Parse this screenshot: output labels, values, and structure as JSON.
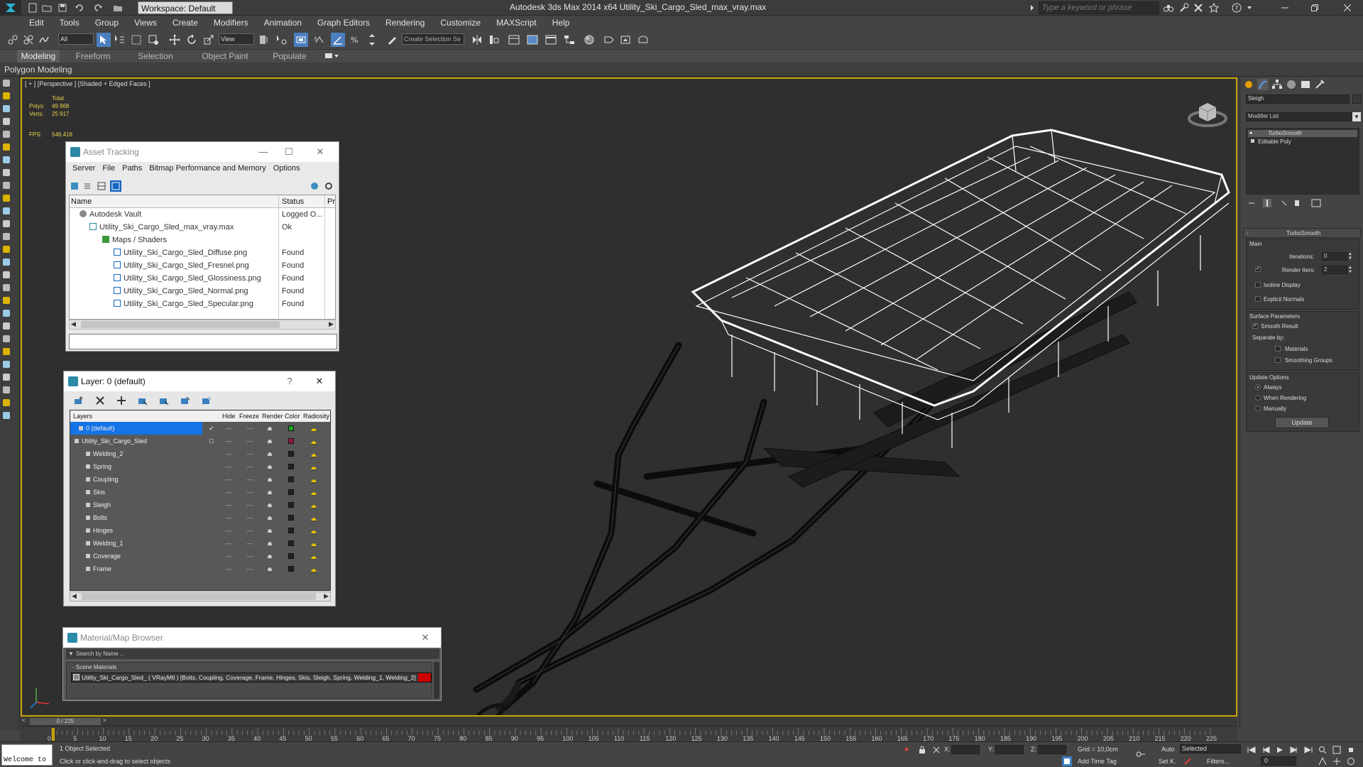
{
  "app": {
    "window_title": "Autodesk 3ds Max  2014 x64     Utility_Ski_Cargo_Sled_max_vray.max",
    "workspace_label": "Workspace: Default",
    "search_placeholder": "Type a keyword or phrase"
  },
  "menu": [
    "Edit",
    "Tools",
    "Group",
    "Views",
    "Create",
    "Modifiers",
    "Animation",
    "Graph Editors",
    "Rendering",
    "Customize",
    "MAXScript",
    "Help"
  ],
  "toolbar": {
    "selection_filter": "All",
    "ref_coord": "View",
    "named_selection": "Create Selection Se"
  },
  "ribbon": {
    "tabs": [
      "Modeling",
      "Freeform",
      "Selection",
      "Object Paint",
      "Populate"
    ],
    "active_tab": "Modeling",
    "subtab": "Polygon Modeling"
  },
  "viewport": {
    "label": "[ + ] [Perspective ] [Shaded + Edged Faces ]",
    "stats": {
      "total_label": "Total",
      "polys_label": "Polys:",
      "polys_value": "49 868",
      "verts_label": "Verts:",
      "verts_value": "25 917",
      "fps_label": "FPS:",
      "fps_value": "546,418"
    }
  },
  "asset_tracking": {
    "title": "Asset Tracking",
    "menu": [
      "Server",
      "File",
      "Paths",
      "Bitmap Performance and Memory",
      "Options"
    ],
    "columns": [
      "Name",
      "Status",
      "Pr"
    ],
    "rows": [
      {
        "name": "Autodesk Vault",
        "status": "Logged O..."
      },
      {
        "name": "Utility_Ski_Cargo_Sled_max_vray.max",
        "status": "Ok"
      },
      {
        "name": "Maps / Shaders",
        "status": ""
      },
      {
        "name": "Utility_Ski_Cargo_Sled_Diffuse.png",
        "status": "Found"
      },
      {
        "name": "Utility_Ski_Cargo_Sled_Fresnel.png",
        "status": "Found"
      },
      {
        "name": "Utility_Ski_Cargo_Sled_Glossiness.png",
        "status": "Found"
      },
      {
        "name": "Utility_Ski_Cargo_Sled_Normal.png",
        "status": "Found"
      },
      {
        "name": "Utility_Ski_Cargo_Sled_Specular.png",
        "status": "Found"
      }
    ]
  },
  "layer_window": {
    "title": "Layer: 0 (default)",
    "help": "?",
    "columns": [
      "Layers",
      "Hide",
      "Freeze",
      "Render",
      "Color",
      "Radiosity"
    ],
    "rows": [
      {
        "name": "0 (default)",
        "color": "#1fa31f"
      },
      {
        "name": "Utility_Ski_Cargo_Sled",
        "color": "#9a1a3a"
      },
      {
        "name": "Welding_2",
        "color": "#222222"
      },
      {
        "name": "Spring",
        "color": "#222222"
      },
      {
        "name": "Coupling",
        "color": "#222222"
      },
      {
        "name": "Skis",
        "color": "#222222"
      },
      {
        "name": "Sleigh",
        "color": "#222222"
      },
      {
        "name": "Bolts",
        "color": "#222222"
      },
      {
        "name": "Hinges",
        "color": "#222222"
      },
      {
        "name": "Welding_1",
        "color": "#222222"
      },
      {
        "name": "Coverage",
        "color": "#222222"
      },
      {
        "name": "Frame",
        "color": "#222222"
      }
    ]
  },
  "material_browser": {
    "title": "Material/Map Browser",
    "search_placeholder": "Search by Name ...",
    "group_label": "- Scene Materials",
    "item": "Utility_Ski_Cargo_Sled_  ( VRayMtl ) [Bolts, Coupling, Coverage, Frame, Hinges, Skis, Sleigh, Spring, Welding_1, Welding_2]",
    "swatch_color": "#cc0000"
  },
  "command_panel": {
    "object_name": "Sleigh",
    "modifier_list_label": "Modifier List",
    "stack": [
      "TurboSmooth",
      "Editable Poly"
    ],
    "rollout_title": "TurboSmooth",
    "main_label": "Main",
    "iterations_label": "Iterations:",
    "iterations_value": "0",
    "render_iters_label": "Render Iters:",
    "render_iters_value": "2",
    "isoline_label": "Isoline Display",
    "explicit_label": "Explicit Normals",
    "surface_label": "Surface Parameters",
    "smooth_result_label": "Smooth Result",
    "separate_by_label": "Separate by:",
    "materials_label": "Materials",
    "smoothing_groups_label": "Smoothing Groups",
    "update_options_label": "Update Options",
    "always_label": "Always",
    "when_rendering_label": "When Rendering",
    "manually_label": "Manually",
    "update_button": "Update"
  },
  "timeline": {
    "slider_label": "0 / 225",
    "ticks": [
      "0",
      "5",
      "10",
      "15",
      "20",
      "25",
      "30",
      "35",
      "40",
      "45",
      "50",
      "55",
      "60",
      "65",
      "70",
      "75",
      "80",
      "85",
      "90",
      "95",
      "100",
      "105",
      "110",
      "115",
      "120",
      "125",
      "130",
      "135",
      "140",
      "145",
      "150",
      "155",
      "160",
      "165",
      "170",
      "175",
      "180",
      "185",
      "190",
      "195",
      "200",
      "205",
      "210",
      "215",
      "220",
      "225"
    ]
  },
  "statusbar": {
    "maxscript": "Welcome to",
    "selection_status": "1 Object Selected",
    "prompt": "Click or click-and-drag to select objects",
    "x_label": "X:",
    "y_label": "Y:",
    "z_label": "Z:",
    "grid": "Grid = 10,0cm",
    "add_time_tag": "Add Time Tag",
    "auto_label": "Auto",
    "setk_label": "Set K.",
    "selected_dropdown": "Selected",
    "filters_label": "Filters...",
    "frame_value": "0"
  }
}
